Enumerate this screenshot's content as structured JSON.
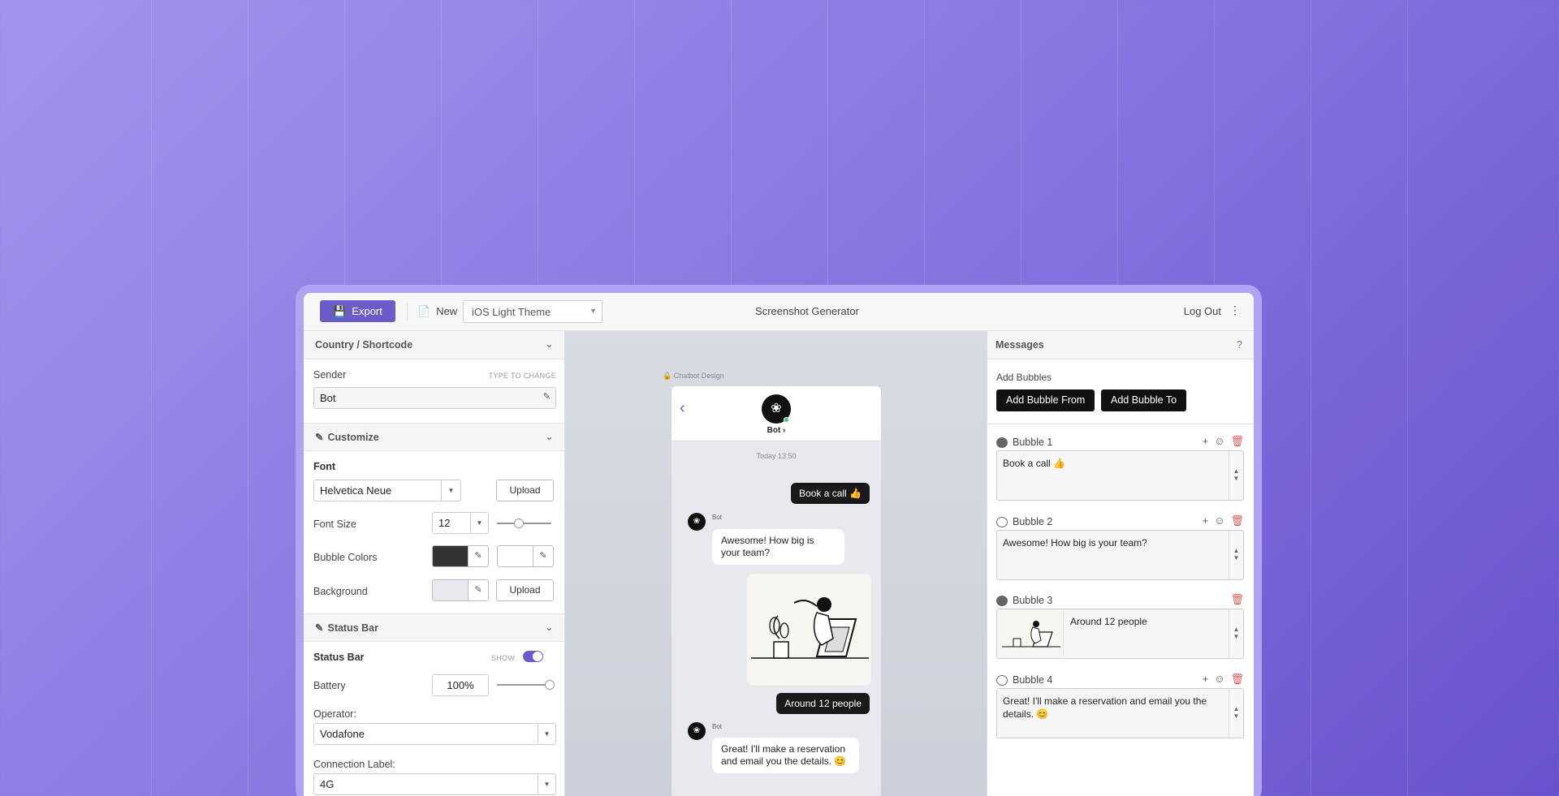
{
  "toolbar": {
    "export_label": "Export",
    "new_label": "New",
    "theme_value": "iOS Light Theme",
    "title": "Screenshot Generator",
    "logout_label": "Log Out"
  },
  "left": {
    "country_section": "Country / Shortcode",
    "sender_label": "Sender",
    "sender_hint": "TYPE TO CHANGE",
    "sender_value": "Bot",
    "customize_section": "Customize",
    "font_label": "Font",
    "font_value": "Helvetica Neue",
    "upload_label": "Upload",
    "font_size_label": "Font Size",
    "font_size_value": "12",
    "bubble_colors_label": "Bubble Colors",
    "background_label": "Background",
    "upload_label_2": "Upload",
    "status_section": "Status Bar",
    "status_bar_label": "Status Bar",
    "show_label": "SHOW",
    "battery_label": "Battery",
    "battery_value": "100%",
    "operator_label": "Operator:",
    "operator_value": "Vodafone",
    "connection_label": "Connection Label:",
    "connection_value": "4G",
    "colors": {
      "bubble_dark": "#333333",
      "bubble_light": "#ffffff",
      "background": "#e8e9ee",
      "accent": "#6a5dc9"
    }
  },
  "preview": {
    "design_label": "Chatbot Design",
    "bot_name": "Bot ›",
    "timestamp": "Today 13:50",
    "msg1": "Book a call 👍",
    "bot_label_1": "Bot",
    "msg2": "Awesome! How big is your team?",
    "msg3": "Around 12 people",
    "bot_label_2": "Bot",
    "msg4": "Great! I'll make a reservation and email you the details. 😊"
  },
  "messages": {
    "title": "Messages",
    "help": "?",
    "add_bubbles_label": "Add Bubbles",
    "add_from": "Add Bubble From",
    "add_to": "Add Bubble To",
    "bubbles": [
      {
        "title": "Bubble 1",
        "text": "Book a call 👍"
      },
      {
        "title": "Bubble 2",
        "text": "Awesome! How big is your team?"
      },
      {
        "title": "Bubble 3",
        "text": "Around 12 people"
      },
      {
        "title": "Bubble 4",
        "text": "Great! I'll make a reservation and email you the details. 😊"
      }
    ]
  }
}
